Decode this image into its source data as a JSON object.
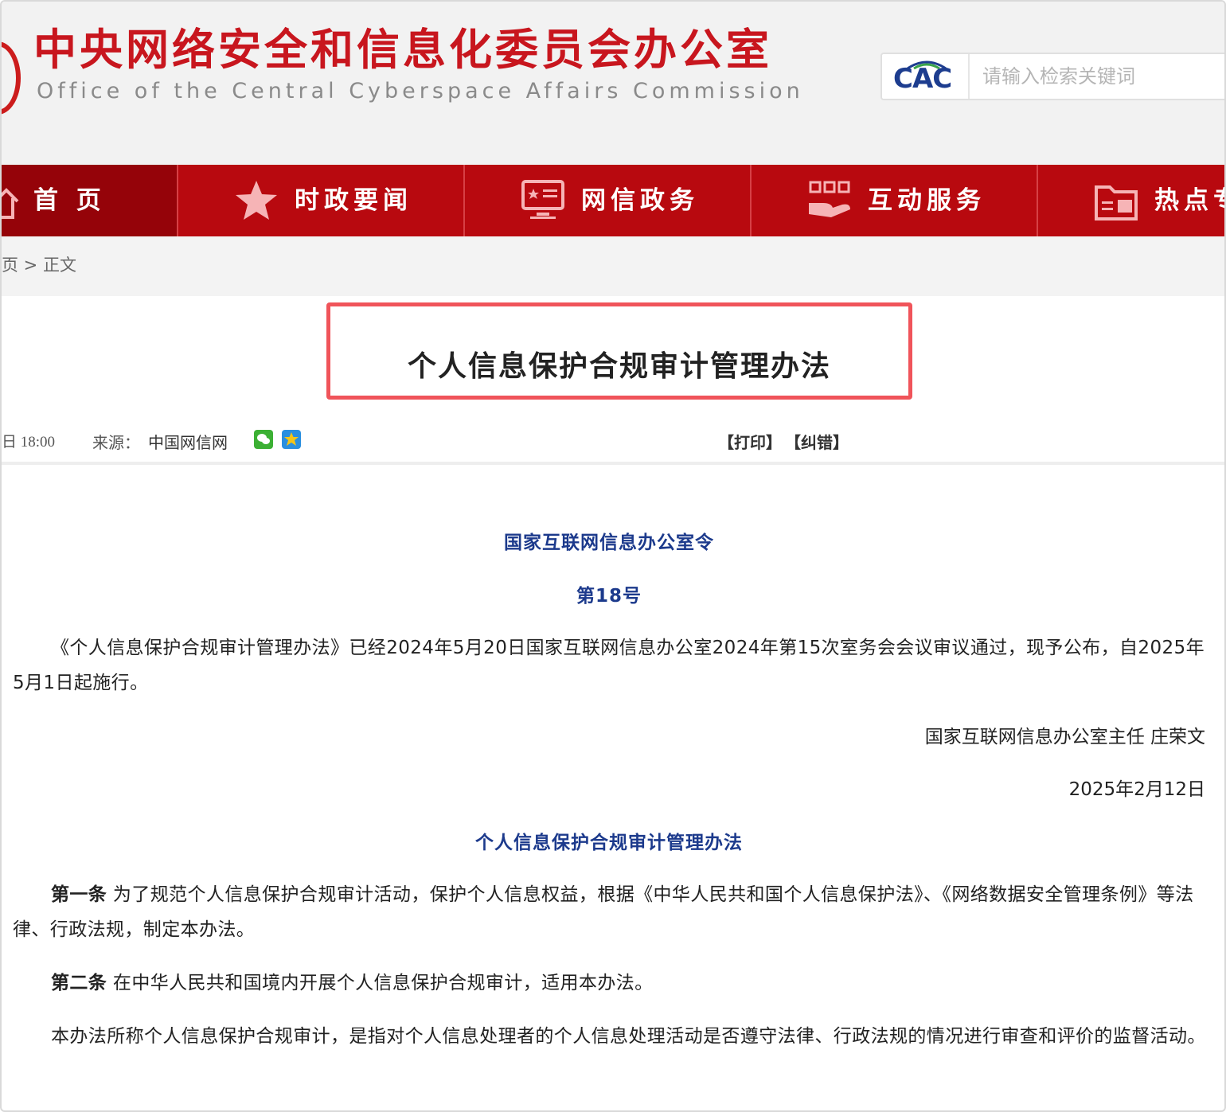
{
  "header": {
    "title_cn": "中央网络安全和信息化委员会办公室",
    "title_en": "Office of the Central Cyberspace Affairs Commission",
    "logo_text": "CAC",
    "search_placeholder": "请输入检索关键词"
  },
  "nav": {
    "items": [
      {
        "label": "首 页",
        "icon": "home-icon"
      },
      {
        "label": "时政要闻",
        "icon": "star-icon"
      },
      {
        "label": "网信政务",
        "icon": "monitor-icon"
      },
      {
        "label": "互动服务",
        "icon": "hand-service-icon"
      },
      {
        "label": "热点专",
        "icon": "folder-icon"
      }
    ]
  },
  "breadcrumb": "页 > 正文",
  "article": {
    "title": "个人信息保护合规审计管理办法",
    "meta": {
      "date": "日 18:00",
      "source_label": "来源：",
      "source": "中国网信网",
      "print": "【打印】",
      "correct": "【纠错】"
    },
    "order_heading": "国家互联网信息办公室令",
    "order_number": "第18号",
    "intro": "《个人信息保护合规审计管理办法》已经2024年5月20日国家互联网信息办公室2024年第15次室务会会议审议通过，现予公布，自2025年5月1日起施行。",
    "signatory": "国家互联网信息办公室主任 庄荣文",
    "sign_date": "2025年2月12日",
    "body_heading": "个人信息保护合规审计管理办法",
    "articles": [
      {
        "label": "第一条",
        "text": " 为了规范个人信息保护合规审计活动，保护个人信息权益，根据《中华人民共和国个人信息保护法》、《网络数据安全管理条例》等法律、行政法规，制定本办法。"
      },
      {
        "label": "第二条",
        "text": " 在中华人民共和国境内开展个人信息保护合规审计，适用本办法。"
      },
      {
        "label": "",
        "text": "本办法所称个人信息保护合规审计，是指对个人信息处理者的个人信息处理活动是否遵守法律、行政法规的情况进行审查和评价的监督活动。"
      }
    ]
  },
  "colors": {
    "brand_red": "#c8161e",
    "nav_red": "#b8090f",
    "nav_active": "#950309",
    "heading_blue": "#1c3a8c",
    "highlight_border": "#f0545a"
  }
}
